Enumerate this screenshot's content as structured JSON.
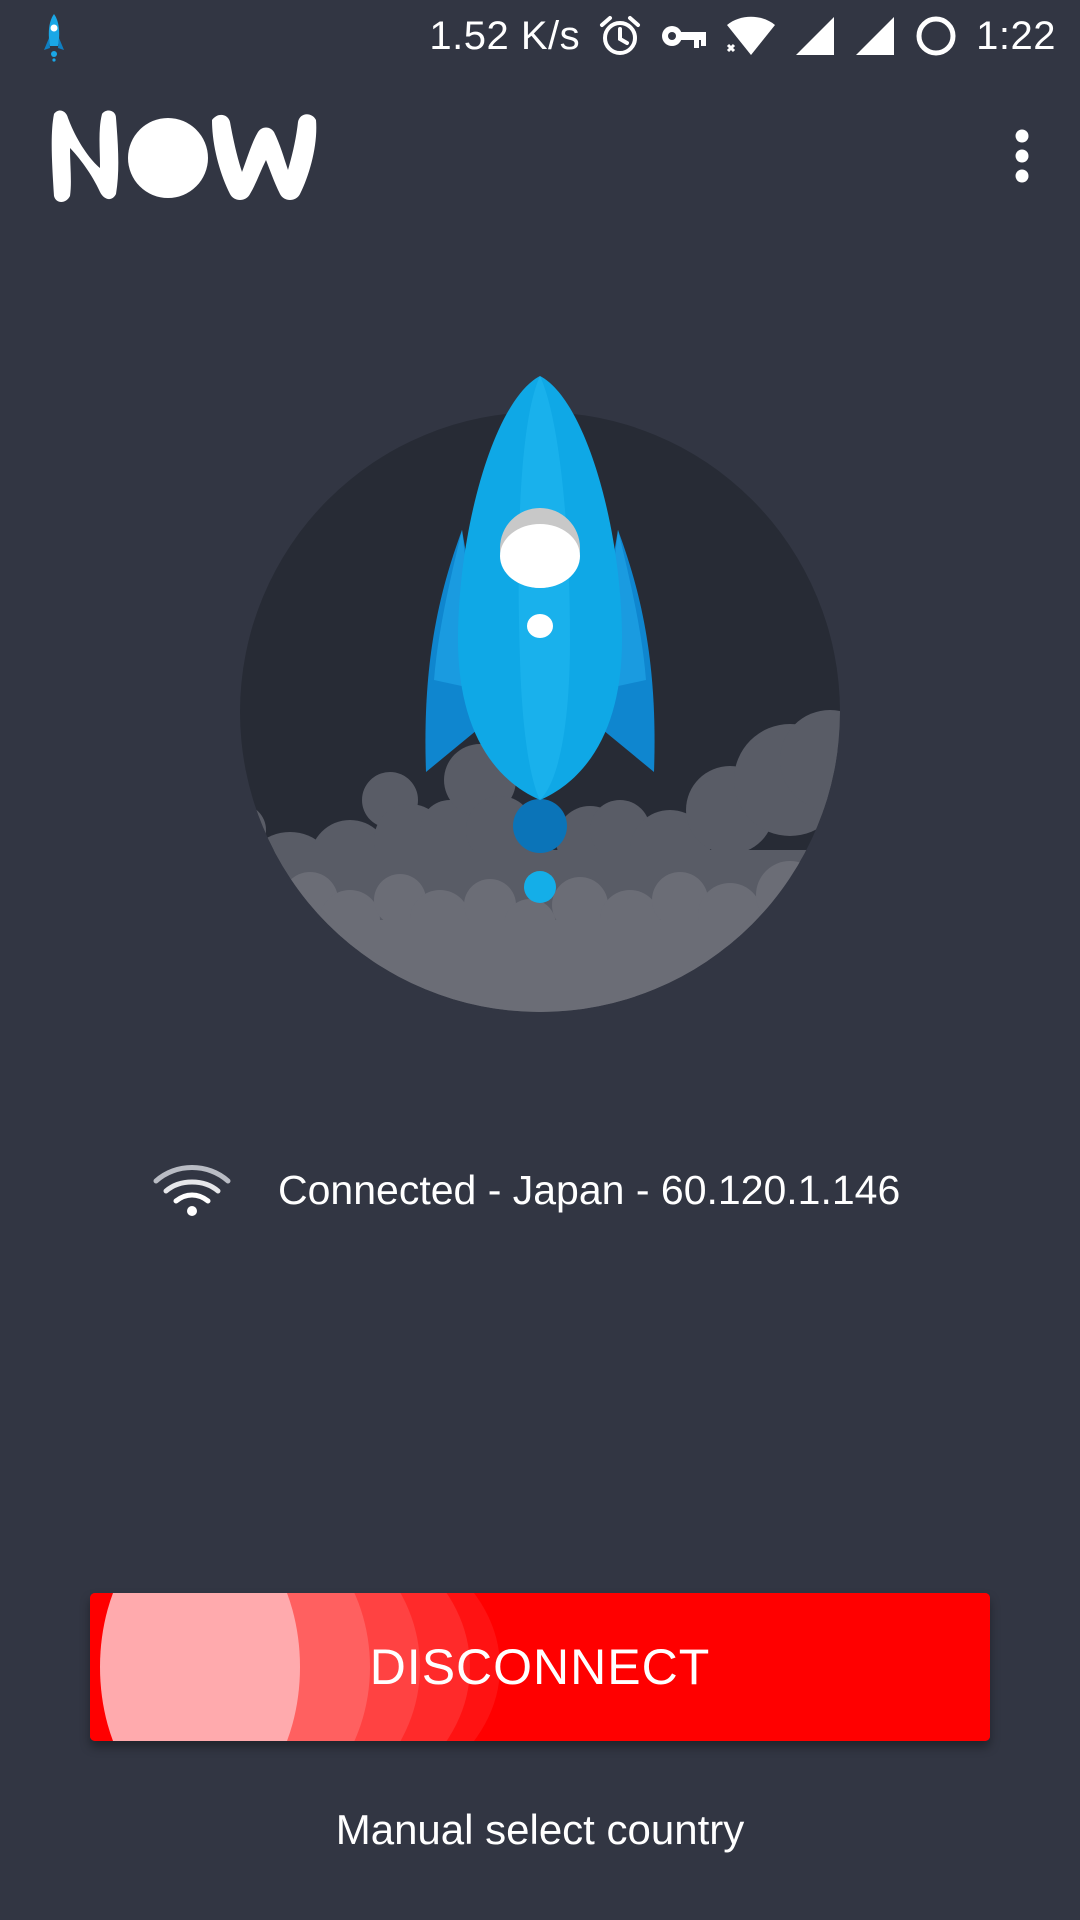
{
  "status_bar": {
    "app_icon": "rocket-icon",
    "network_speed": "1.52 K/s",
    "icons": [
      "alarm-icon",
      "vpn-key-icon",
      "wifi-icon",
      "signal-icon",
      "signal-icon",
      "battery-circle-icon"
    ],
    "time": "1:22"
  },
  "app_bar": {
    "logo_text": "NOW",
    "menu_icon": "more-vert-icon"
  },
  "hero": {
    "illustration": "rocket-launch-illustration"
  },
  "connection": {
    "icon": "wifi-icon",
    "status_text": "Connected - Japan - 60.120.1.146"
  },
  "actions": {
    "disconnect_label": "DISCONNECT",
    "manual_select_label": "Manual select country"
  },
  "colors": {
    "background": "#323643",
    "circle": "#272b35",
    "rocket": "#0fa8e6",
    "disconnect": "#ff0000",
    "smoke": "#6b6d76"
  }
}
